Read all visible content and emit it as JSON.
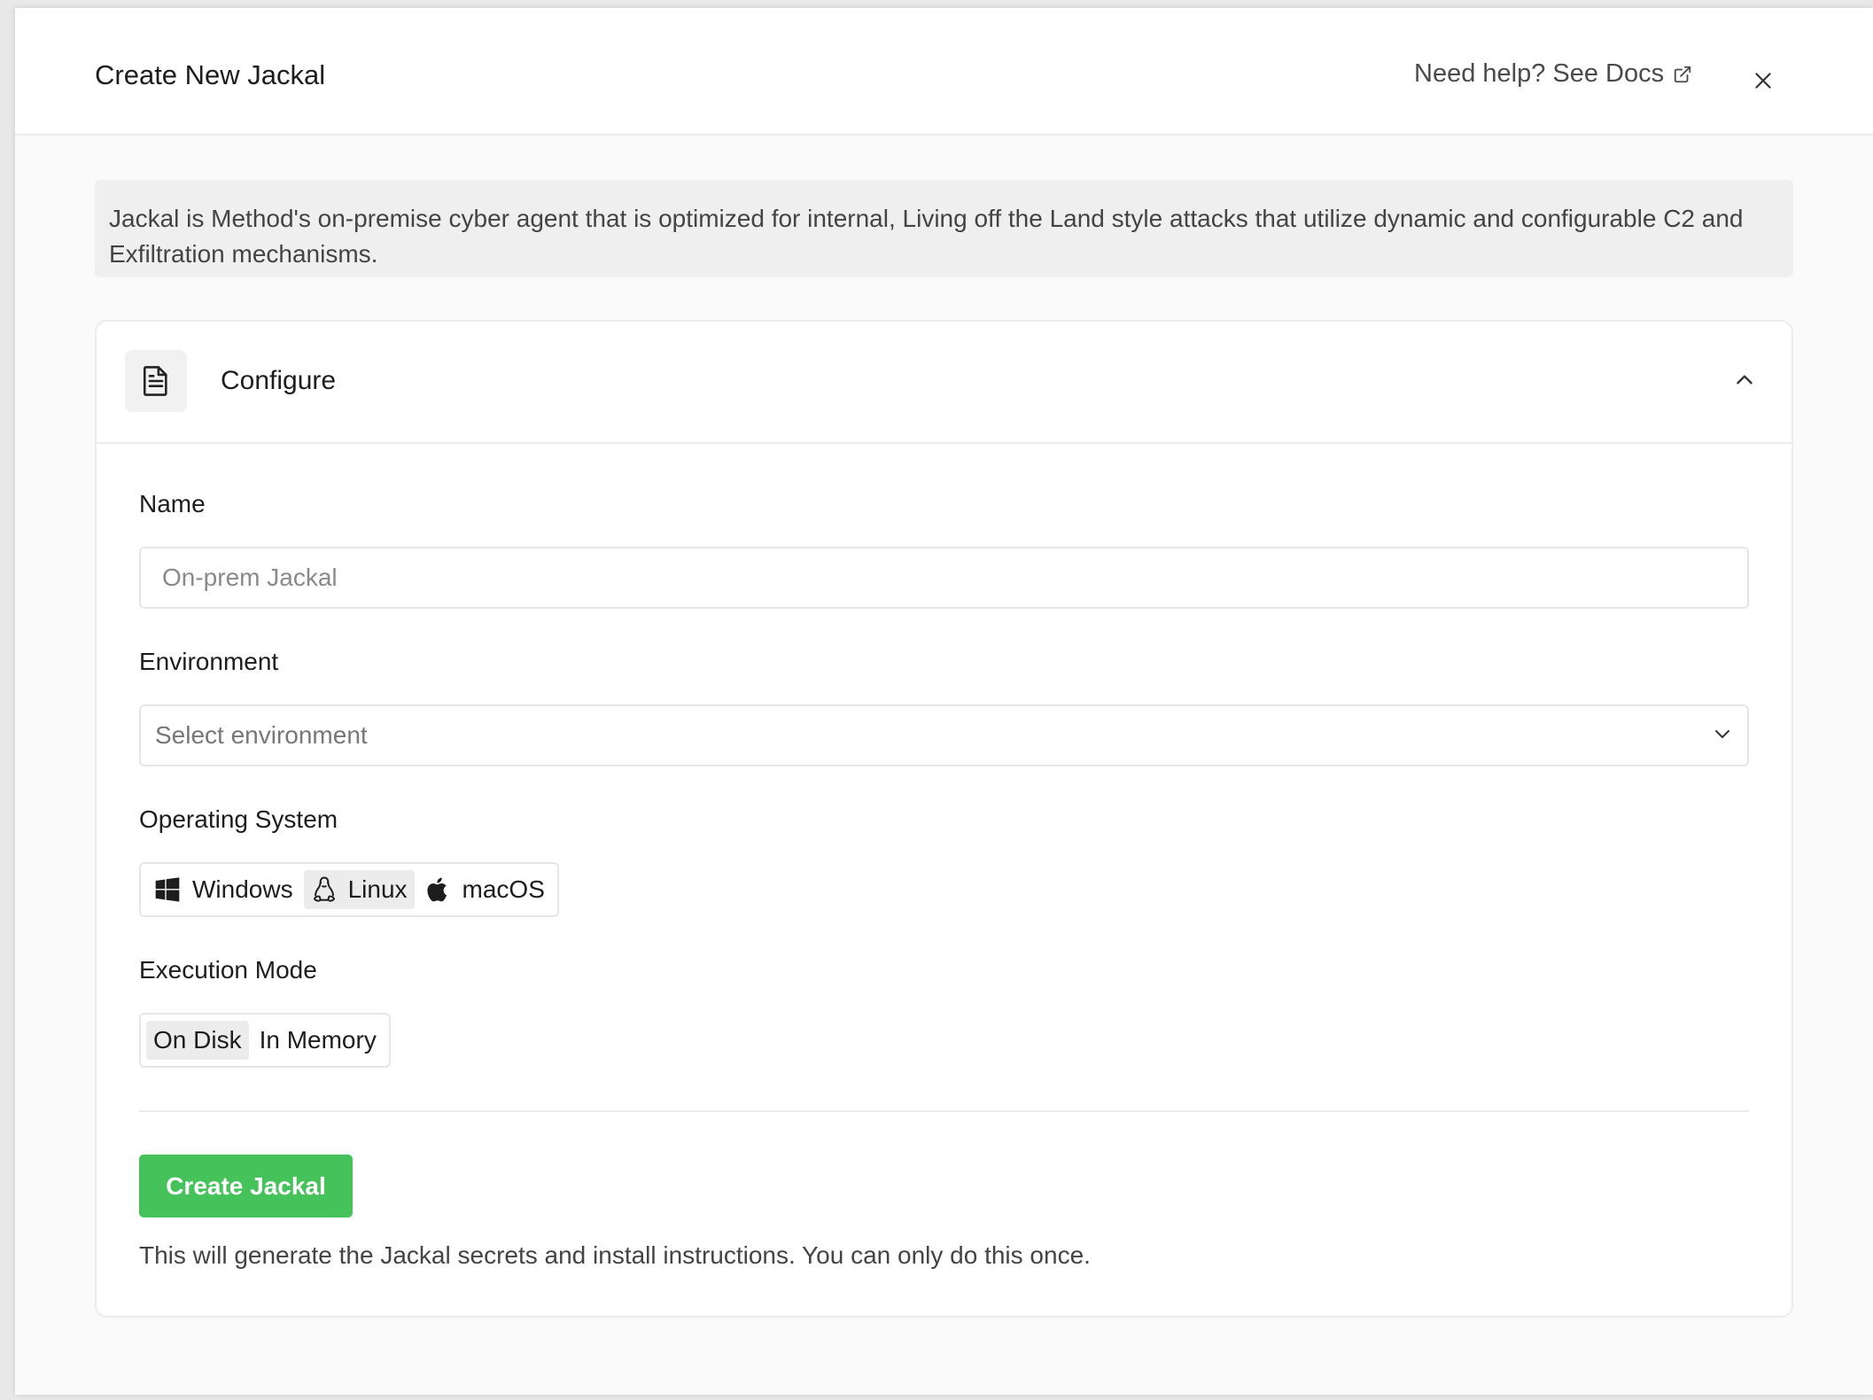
{
  "modal": {
    "title": "Create New Jackal",
    "help_link": "Need help? See Docs"
  },
  "intro_text": "Jackal is Method's on-premise cyber agent that is optimized for internal, Living off the Land style attacks that utilize dynamic and configurable C2 and Exfiltration mechanisms.",
  "configure": {
    "title": "Configure",
    "name": {
      "label": "Name",
      "value": "",
      "placeholder": "On-prem Jackal"
    },
    "environment": {
      "label": "Environment",
      "placeholder": "Select environment"
    },
    "operating_system": {
      "label": "Operating System",
      "options": [
        "Windows",
        "Linux",
        "macOS"
      ],
      "selected": "Linux"
    },
    "execution_mode": {
      "label": "Execution Mode",
      "options": [
        "On Disk",
        "In Memory"
      ],
      "selected": "On Disk"
    },
    "submit_label": "Create Jackal",
    "note": "This will generate the Jackal secrets and install instructions. You can only do this once."
  },
  "icons": {
    "external": "external-link-icon",
    "close": "close-icon",
    "document": "document-icon",
    "collapse": "chevron-up-icon",
    "dropdown": "chevron-down-icon",
    "windows": "windows-icon",
    "linux": "linux-icon",
    "macos": "apple-icon"
  },
  "colors": {
    "primary_button": "#45c35a",
    "selected_segment": "#ececec"
  }
}
